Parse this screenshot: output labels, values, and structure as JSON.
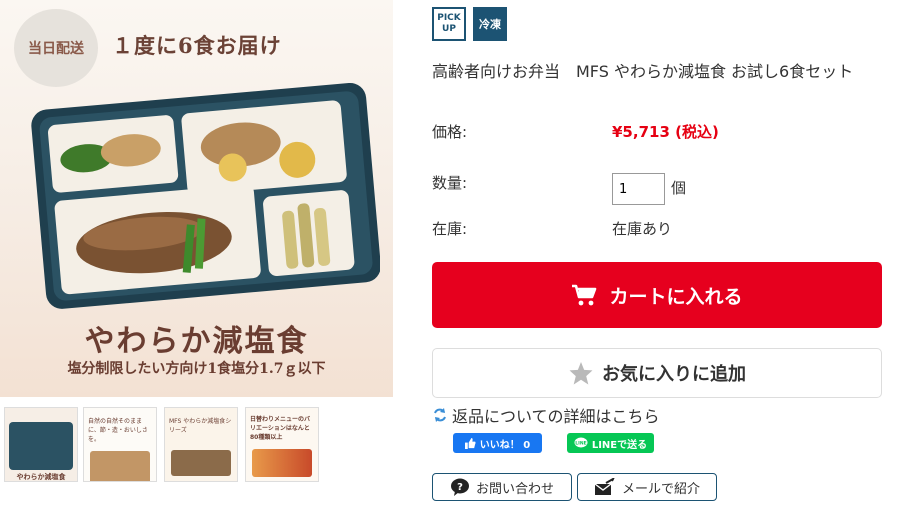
{
  "image": {
    "badge": "当日配送",
    "headline": "１度に6食お届け",
    "product_name": "やわらか減塩食",
    "product_sub": "塩分制限したい方向け1食塩分1.7ｇ以下"
  },
  "thumbnails": [
    {
      "caption": "やわらか減塩食"
    },
    {
      "caption": "自然の自然そのままに、節・造・おいしさを。"
    },
    {
      "caption": "MFS やわらか減塩食シリーズ"
    },
    {
      "caption": "日替わりメニューのバリエーションはなんと 80種類以上"
    }
  ],
  "tags": {
    "pick_line1": "PICK",
    "pick_line2": "UP",
    "frozen": "冷凍"
  },
  "product": {
    "title": "高齢者向けお弁当　MFS やわらか減塩食 お試し6食セット",
    "price_label": "価格:",
    "price": "¥5,713 (税込)",
    "qty_label": "数量:",
    "qty_value": "1",
    "qty_unit": "個",
    "stock_label": "在庫:",
    "stock_value": "在庫あり"
  },
  "actions": {
    "cart": "カートに入れる",
    "favorite": "お気に入りに追加",
    "returns": "返品についての詳細はこちら",
    "fb_like": "いいね！ 0",
    "line_send": "LINEで送る",
    "inquiry": "お問い合わせ",
    "mail": "メールで紹介"
  },
  "colors": {
    "accent_red": "#e6001e",
    "navy": "#1c5373",
    "fb": "#1877f2",
    "line": "#06c755"
  }
}
